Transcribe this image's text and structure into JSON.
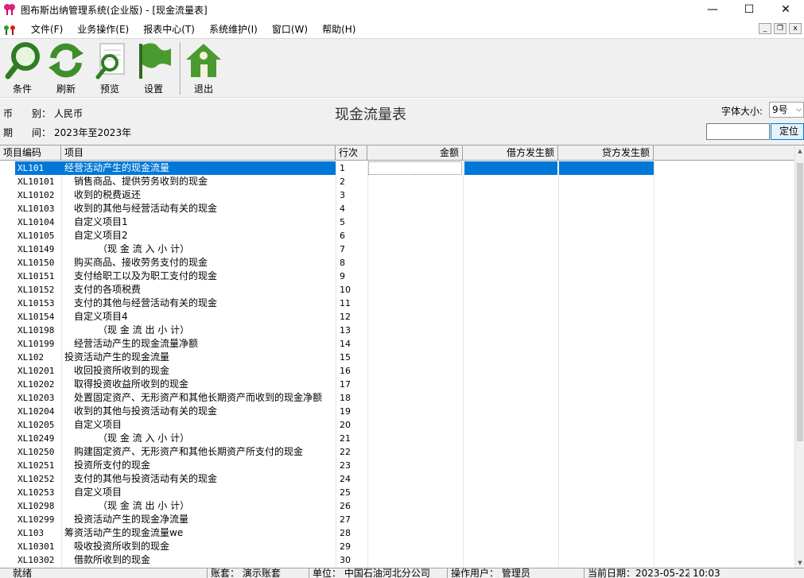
{
  "window": {
    "title": "图布斯出纳管理系统(企业版) - [现金流量表]",
    "minimize": "—",
    "maximize": "☐",
    "close": "✕"
  },
  "menu": {
    "items": [
      "文件(F)",
      "业务操作(E)",
      "报表中心(T)",
      "系统维护(I)",
      "窗口(W)",
      "帮助(H)"
    ],
    "mdi_min": "_",
    "mdi_restore": "❐",
    "mdi_close": "x"
  },
  "toolbar": {
    "buttons": [
      {
        "label": "条件",
        "icon": "magnifier-icon"
      },
      {
        "label": "刷新",
        "icon": "refresh-icon"
      },
      {
        "label": "预览",
        "icon": "preview-icon"
      },
      {
        "label": "设置",
        "icon": "flag-icon"
      },
      {
        "label": "退出",
        "icon": "home-icon"
      }
    ]
  },
  "header": {
    "currency_label": "币　　别：",
    "currency_value": "人民币",
    "period_label": "期　　间：",
    "period_value": "2023年至2023年",
    "report_title": "现金流量表",
    "font_size_label": "字体大小:",
    "font_size_value": "9号",
    "locate_value": "",
    "locate_button": "定位"
  },
  "grid": {
    "columns": [
      "项目编码",
      "项目",
      "行次",
      "金额",
      "借方发生额",
      "贷方发生额"
    ],
    "rows": [
      {
        "code": "XL101",
        "item": "经营活动产生的现金流量",
        "indent": 0,
        "line": "1"
      },
      {
        "code": "XL10101",
        "item": "销售商品、提供劳务收到的现金",
        "indent": 1,
        "line": "2"
      },
      {
        "code": "XL10102",
        "item": "收到的税费返还",
        "indent": 1,
        "line": "3"
      },
      {
        "code": "XL10103",
        "item": "收到的其他与经营活动有关的现金",
        "indent": 1,
        "line": "4"
      },
      {
        "code": "XL10104",
        "item": "自定义项目1",
        "indent": 1,
        "line": "5"
      },
      {
        "code": "XL10105",
        "item": "自定义项目2",
        "indent": 1,
        "line": "6"
      },
      {
        "code": "XL10149",
        "item": "（现 金 流 入 小 计）",
        "indent": 2,
        "line": "7"
      },
      {
        "code": "XL10150",
        "item": "购买商品、接收劳务支付的现金",
        "indent": 1,
        "line": "8"
      },
      {
        "code": "XL10151",
        "item": "支付给职工以及为职工支付的现金",
        "indent": 1,
        "line": "9"
      },
      {
        "code": "XL10152",
        "item": "支付的各项税费",
        "indent": 1,
        "line": "10"
      },
      {
        "code": "XL10153",
        "item": "支付的其他与经营活动有关的现金",
        "indent": 1,
        "line": "11"
      },
      {
        "code": "XL10154",
        "item": "自定义项目4",
        "indent": 1,
        "line": "12"
      },
      {
        "code": "XL10198",
        "item": "（现 金 流 出 小 计）",
        "indent": 2,
        "line": "13"
      },
      {
        "code": "XL10199",
        "item": "经营活动产生的现金流量净额",
        "indent": 1,
        "line": "14"
      },
      {
        "code": "XL102",
        "item": "投资活动产生的现金流量",
        "indent": 0,
        "line": "15"
      },
      {
        "code": "XL10201",
        "item": "收回投资所收到的现金",
        "indent": 1,
        "line": "16"
      },
      {
        "code": "XL10202",
        "item": "取得投资收益所收到的现金",
        "indent": 1,
        "line": "17"
      },
      {
        "code": "XL10203",
        "item": "处置固定资产、无形资产和其他长期资产而收到的现金净额",
        "indent": 1,
        "line": "18"
      },
      {
        "code": "XL10204",
        "item": "收到的其他与投资活动有关的现金",
        "indent": 1,
        "line": "19"
      },
      {
        "code": "XL10205",
        "item": "自定义项目",
        "indent": 1,
        "line": "20"
      },
      {
        "code": "XL10249",
        "item": "（现 金 流 入 小 计）",
        "indent": 2,
        "line": "21"
      },
      {
        "code": "XL10250",
        "item": "购建固定资产、无形资产和其他长期资产所支付的现金",
        "indent": 1,
        "line": "22"
      },
      {
        "code": "XL10251",
        "item": "投资所支付的现金",
        "indent": 1,
        "line": "23"
      },
      {
        "code": "XL10252",
        "item": "支付的其他与投资活动有关的现金",
        "indent": 1,
        "line": "24"
      },
      {
        "code": "XL10253",
        "item": "自定义项目",
        "indent": 1,
        "line": "25"
      },
      {
        "code": "XL10298",
        "item": "（现 金 流 出 小 计）",
        "indent": 2,
        "line": "26"
      },
      {
        "code": "XL10299",
        "item": "投资活动产生的现金净流量",
        "indent": 1,
        "line": "27"
      },
      {
        "code": "XL103",
        "item": "筹资活动产生的现金流量we",
        "indent": 0,
        "line": "28"
      },
      {
        "code": "XL10301",
        "item": "吸收投资所收到的现金",
        "indent": 1,
        "line": "29"
      },
      {
        "code": "XL10302",
        "item": "借款所收到的现金",
        "indent": 1,
        "line": "30"
      }
    ]
  },
  "status": {
    "ready": "就绪",
    "account": "账套：  演示账套",
    "unit": "单位：  中国石油河北分公司",
    "user": "操作用户：  管理员",
    "date": "当前日期：2023-05-22",
    "time": "10:03"
  },
  "colors": {
    "selection": "#0078d7",
    "toolbar_bg": "#f0f0f0",
    "icon_green": "#3f8f2a"
  }
}
